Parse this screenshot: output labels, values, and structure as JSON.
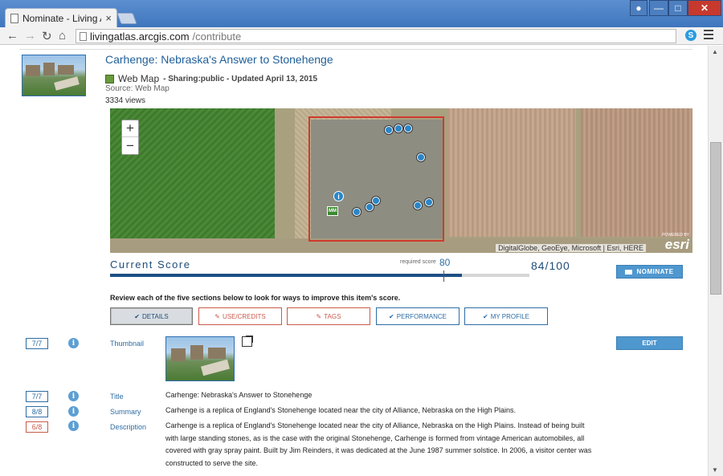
{
  "browser": {
    "tab_title": "Nominate - Living At",
    "tab_close": "×",
    "url_host": "livingatlas.arcgis.com",
    "url_path": "/contribute"
  },
  "item": {
    "title": "Carhenge: Nebraska's Answer to Stonehenge",
    "type": "Web Map",
    "meta": " - Sharing:public - Updated April 13, 2015",
    "source": "Source: Web Map",
    "views": "3334 views"
  },
  "map": {
    "zoom_in": "+",
    "zoom_out": "−",
    "info_glyph": "i",
    "marker_label": "MM",
    "attribution": "DigitalGlobe, GeoEye, Microsoft | Esri, HERE",
    "powered_by": "POWERED BY",
    "logo": "esri"
  },
  "score": {
    "label": "Current Score",
    "required_label": "required score",
    "required_value": "80",
    "value": "84/100",
    "fraction": 0.84,
    "nominate_label": "NOMINATE"
  },
  "review_text": "Review each of the five sections below to look for ways to improve this item's score.",
  "sections": [
    {
      "label": "DETAILS",
      "icon": "✔"
    },
    {
      "label": "USE/CREDITS",
      "icon": "✎"
    },
    {
      "label": "TAGS",
      "icon": "✎"
    },
    {
      "label": "PERFORMANCE",
      "icon": "✔"
    },
    {
      "label": "MY PROFILE",
      "icon": "✔"
    }
  ],
  "details": {
    "edit_label": "EDIT",
    "info_glyph": "i",
    "thumbnail": {
      "score": "7/7",
      "label": "Thumbnail"
    },
    "title": {
      "score": "7/7",
      "label": "Title",
      "value": "Carhenge: Nebraska's Answer to Stonehenge"
    },
    "summary": {
      "score": "8/8",
      "label": "Summary",
      "value": "Carhenge is a replica of England's Stonehenge located near the city of Alliance, Nebraska on the High Plains."
    },
    "description": {
      "score": "6/8",
      "label": "Description",
      "lines": [
        "Carhenge is a replica of England's Stonehenge located near the city of Alliance, Nebraska on the High Plains. Instead of being built",
        "with large standing stones, as is the case with the original Stonehenge, Carhenge is formed from vintage American automobiles, all",
        "covered with gray spray paint. Built by Jim Reinders, it was dedicated at the June 1987 summer solstice. In 2006, a visitor center was",
        "constructed to serve the site."
      ]
    }
  },
  "colors": {
    "accent": "#2e6da4",
    "warning": "#c95b4a",
    "score_fill": "#1c4f86",
    "button": "#4f97cf"
  }
}
